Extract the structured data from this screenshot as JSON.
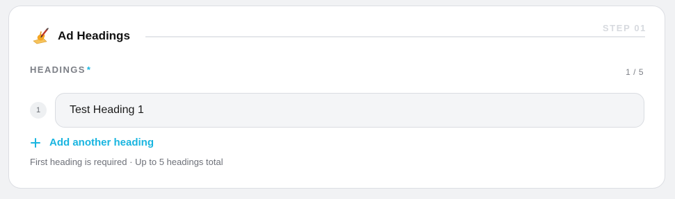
{
  "card": {
    "title": "Ad Headings",
    "title_icon": "writing-hand-icon",
    "step_label": "STEP 01"
  },
  "headings_field": {
    "label": "HEADINGS",
    "required_marker": "*",
    "counter": "1 / 5",
    "rows": [
      {
        "number": "1",
        "value": "Test Heading 1"
      }
    ]
  },
  "add_button": {
    "icon": "plus-icon",
    "label": "Add another heading"
  },
  "helper_text": "First heading is required · Up to 5 headings total",
  "colors": {
    "accent": "#19b5e0",
    "muted_label": "#7c7f86",
    "step_label": "#d7dadf"
  }
}
